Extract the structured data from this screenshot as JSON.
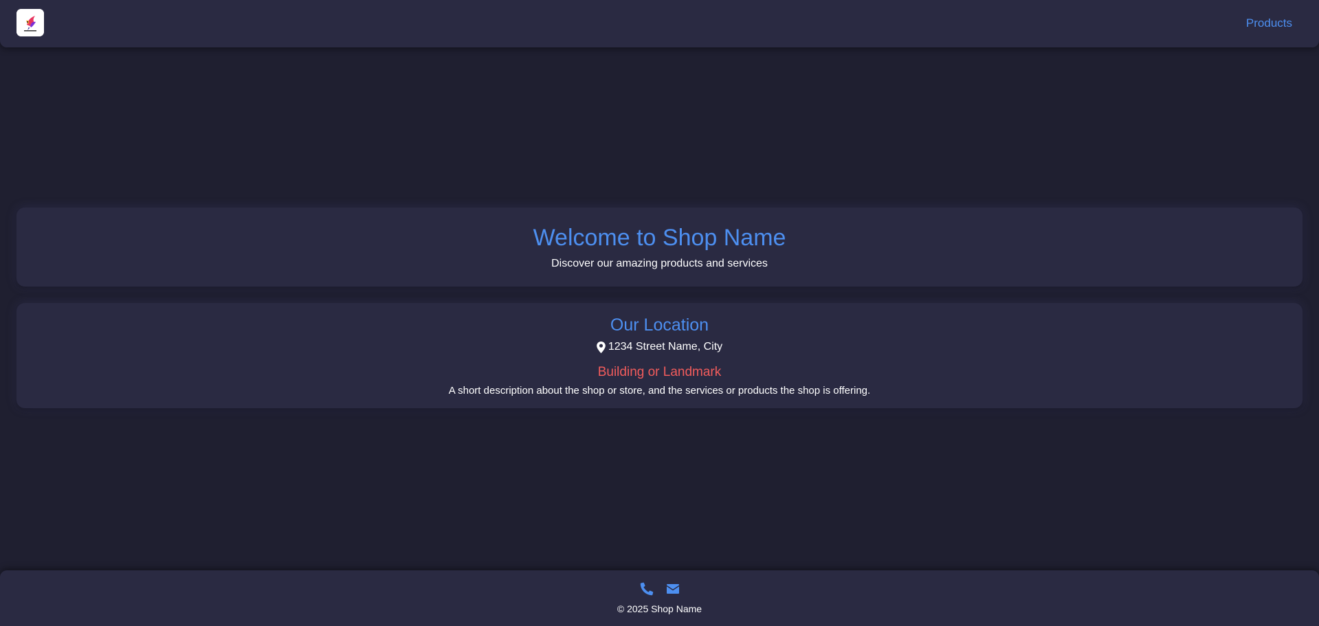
{
  "header": {
    "nav": {
      "products_label": "Products"
    }
  },
  "welcome": {
    "title": "Welcome to Shop Name",
    "subtitle": "Discover our amazing products and services"
  },
  "location": {
    "title": "Our Location",
    "address": "1234 Street Name, City",
    "landmark": "Building or Landmark",
    "description": "A short description about the shop or store, and the services or products the shop is offering."
  },
  "footer": {
    "icons": [
      "phone-icon",
      "envelope-icon"
    ],
    "copyright": "© 2025 Shop Name"
  },
  "colors": {
    "background": "#1f1f30",
    "surface": "#2a2a42",
    "accent": "#4d8ff0",
    "landmark": "#f25c5c",
    "text": "#ffffff"
  }
}
